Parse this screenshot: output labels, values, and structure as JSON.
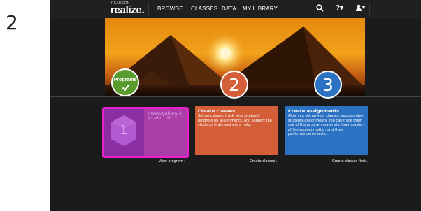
{
  "step_number": "2",
  "nav": {
    "brand_small": "PEARSON",
    "brand": "realize.",
    "items": [
      "BROWSE",
      "CLASSES",
      "DATA",
      "MY LIBRARY"
    ],
    "help_label": "?▾",
    "user_label": "▾"
  },
  "steps": {
    "programs_label": "Programs",
    "classes_number": "2",
    "assignments_number": "3"
  },
  "cards": {
    "program": {
      "title_line1": "Investigations 3",
      "title_line2": "Grade 1 2017",
      "badge_number": "1",
      "link": "View program"
    },
    "classes": {
      "title": "Create classes",
      "body": "Set up classes, track your students' progress on assignments, and support the students that need extra help.",
      "link": "Create classes"
    },
    "assignments": {
      "title": "Create assignments",
      "body": "After you set up your classes, you can give students assignments. You can track their use of the program materials, their mastery of the subject matter, and their performance on tests.",
      "link": "Create classes first"
    }
  },
  "colors": {
    "programs_green": "#5a9b2d",
    "classes_orange": "#d35e37",
    "assignments_blue": "#2c72c3",
    "selection_magenta": "#ea1fd0"
  }
}
